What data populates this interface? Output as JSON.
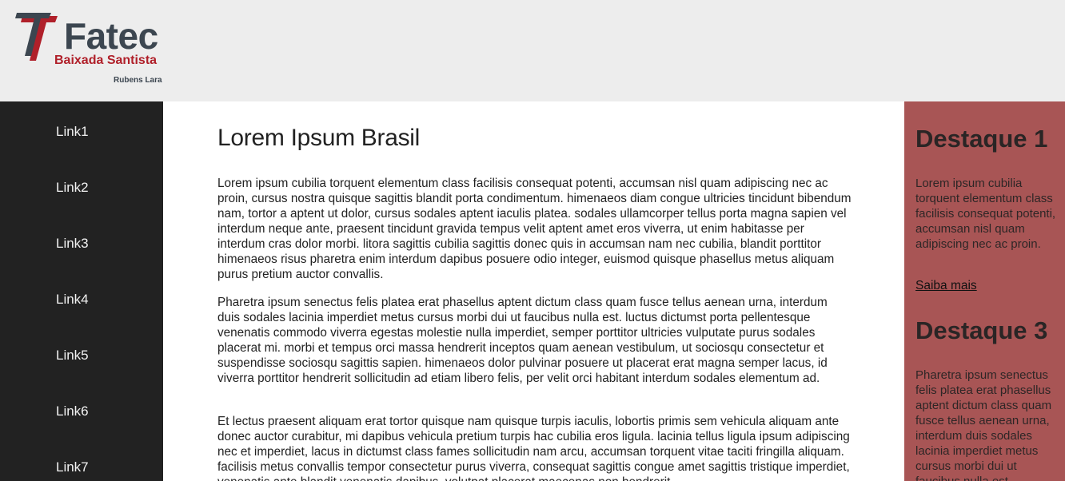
{
  "header": {
    "logo": {
      "name": "Fatec",
      "subtitle": "Baixada Santista",
      "unit": "Rubens Lara",
      "colors": {
        "dark": "#3c4650",
        "red": "#b0202a"
      }
    }
  },
  "nav": {
    "links": [
      {
        "label": "Link1"
      },
      {
        "label": "Link2"
      },
      {
        "label": "Link3"
      },
      {
        "label": "Link4"
      },
      {
        "label": "Link5"
      },
      {
        "label": "Link6"
      },
      {
        "label": "Link7"
      }
    ]
  },
  "main": {
    "title": "Lorem Ipsum Brasil",
    "paragraphs": [
      "Lorem ipsum cubilia torquent elementum class facilisis consequat potenti, accumsan nisl quam adipiscing nec ac proin, cursus nostra quisque sagittis blandit porta condimentum. himenaeos diam congue ultricies tincidunt bibendum nam, tortor a aptent ut dolor, cursus sodales aptent iaculis platea. sodales ullamcorper tellus porta magna sapien vel interdum neque ante, praesent tincidunt gravida tempus velit aptent amet eros viverra, ut enim habitasse per interdum cras dolor morbi. litora sagittis cubilia sagittis donec quis in accumsan nam nec cubilia, blandit porttitor himenaeos risus pharetra enim interdum dapibus posuere odio integer, euismod quisque phasellus metus aliquam purus pretium auctor convallis.",
      "Pharetra ipsum senectus felis platea erat phasellus aptent dictum class quam fusce tellus aenean urna, interdum duis sodales lacinia imperdiet metus cursus morbi dui ut faucibus nulla est. luctus dictumst porta pellentesque venenatis commodo viverra egestas molestie nulla imperdiet, semper porttitor ultricies vulputate purus sodales placerat mi. morbi et tempus orci massa hendrerit inceptos quam aenean vestibulum, ut sociosqu consectetur et suspendisse sociosqu sagittis sapien. himenaeos dolor pulvinar posuere ut placerat erat magna semper lacus, id viverra porttitor hendrerit sollicitudin ad etiam libero felis, per velit orci habitant interdum sodales elementum ad.",
      "Et lectus praesent aliquam erat tortor quisque nam quisque turpis iaculis, lobortis primis sem vehicula aliquam ante donec auctor curabitur, mi dapibus vehicula pretium turpis hac cubilia eros ligula. lacinia tellus ligula ipsum adipiscing nec et imperdiet, lacus in dictumst class fames sollicitudin nam arcu, accumsan torquent vitae taciti fringilla aliquam. facilisis metus convallis tempor consectetur purus viverra, consequat sagittis congue amet sagittis tristique imperdiet, venenatis ante blandit venenatis dapibus, volutpat placerat maecenas non hendrerit"
    ]
  },
  "aside": {
    "background": "#a85555",
    "highlights": [
      {
        "title": "Destaque 1",
        "text": "Lorem ipsum cubilia torquent elementum class facilisis consequat potenti, accumsan nisl quam adipiscing nec ac proin.",
        "link": "Saiba mais"
      },
      {
        "title": "Destaque 3",
        "text": "Pharetra ipsum senectus felis platea erat phasellus aptent dictum class quam fusce tellus aenean urna, interdum duis sodales lacinia imperdiet metus cursus morbi dui ut faucibus nulla est."
      }
    ]
  }
}
